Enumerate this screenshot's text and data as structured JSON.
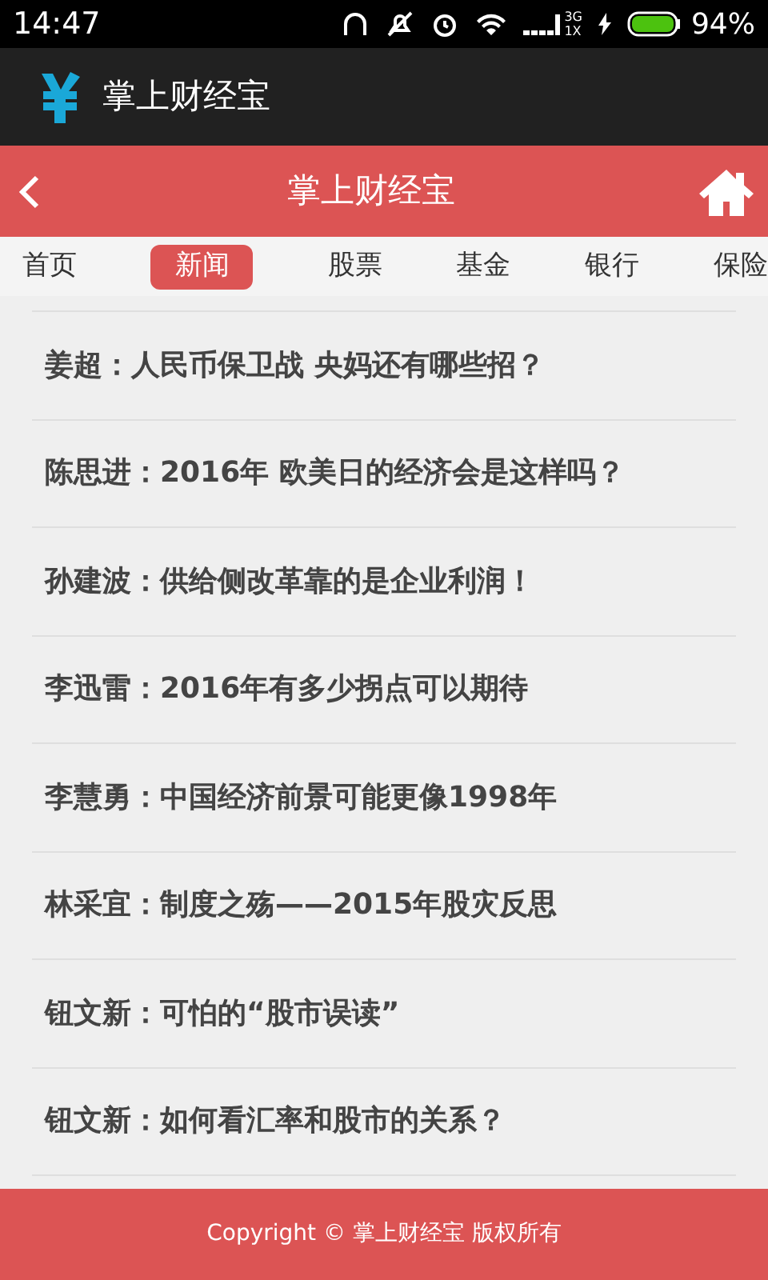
{
  "status_bar": {
    "time": "14:47",
    "network_top": "3G",
    "network_bottom": "1X",
    "battery": "94%"
  },
  "app_bar": {
    "title": "掌上财经宝"
  },
  "header": {
    "title": "掌上财经宝"
  },
  "tabs": [
    {
      "label": "首页",
      "selected": false
    },
    {
      "label": "新闻",
      "selected": true
    },
    {
      "label": "股票",
      "selected": false
    },
    {
      "label": "基金",
      "selected": false
    },
    {
      "label": "银行",
      "selected": false
    },
    {
      "label": "保险",
      "selected": false
    }
  ],
  "articles": [
    "姜超：人民币保卫战 央妈还有哪些招？",
    "陈思进：2016年 欧美日的经济会是这样吗？",
    "孙建波：供给侧改革靠的是企业利润！",
    "李迅雷：2016年有多少拐点可以期待",
    "李慧勇：中国经济前景可能更像1998年",
    "林采宜：制度之殇——2015年股灾反思",
    "钮文新：可怕的“股市误读”",
    "钮文新：如何看汇率和股市的关系？"
  ],
  "footer": "Copyright © 掌上财经宝 版权所有"
}
